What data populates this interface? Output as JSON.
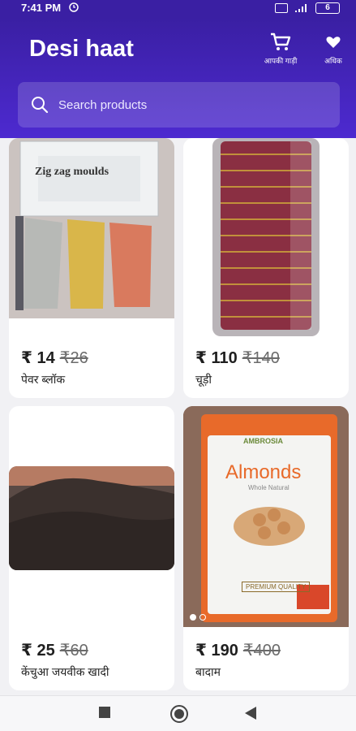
{
  "status_bar": {
    "time": "7:41 PM",
    "battery": "6"
  },
  "header": {
    "title": "Desi haat",
    "cart_label": "आपकी गाड़ी",
    "more_label": "अधिक"
  },
  "search": {
    "placeholder": "Search products"
  },
  "products": [
    {
      "price": "₹ 14",
      "mrp": "₹26",
      "name": "पेवर ब्लॉक",
      "image_caption": "Zig zag moulds"
    },
    {
      "price": "₹ 110",
      "mrp": "₹140",
      "name": "चूड़ी"
    },
    {
      "price": "₹ 25",
      "mrp": "₹60",
      "name": "केंचुआ जयवीक खादी"
    },
    {
      "price": "₹ 190",
      "mrp": "₹400",
      "name": "बादाम",
      "image_brand": "AMBROSIA",
      "image_product": "Almonds",
      "image_sub": "Whole Natural",
      "image_badge": "PREMIUM QUALITY"
    }
  ],
  "colors": {
    "header": "#3a1fa3",
    "accent": "#4d2ad0"
  }
}
